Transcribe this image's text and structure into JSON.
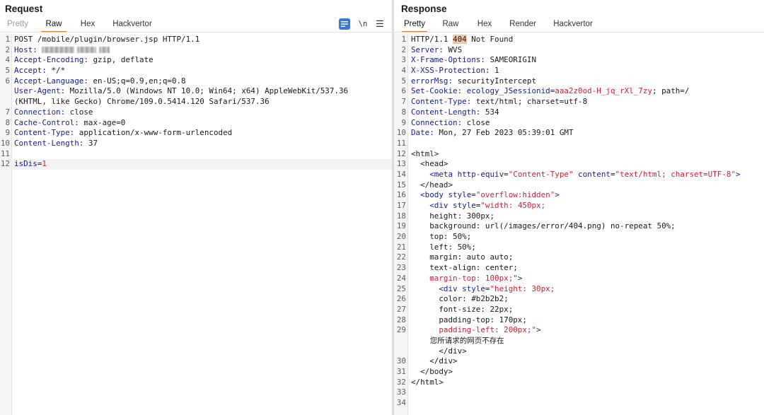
{
  "request": {
    "title": "Request",
    "tabs": [
      "Pretty",
      "Raw",
      "Hex",
      "Hackvertor"
    ],
    "active_tab": "Raw",
    "toolbar": {
      "wrap_icon": "wrap-lines-icon",
      "newline_label": "\\n",
      "menu_icon": "hamburger-menu-icon"
    },
    "lines": {
      "l1": "POST /mobile/plugin/browser.jsp HTTP/1.1",
      "l2k": "Host:",
      "l3k": "Accept-Encoding:",
      "l3v": " gzip, deflate",
      "l4k": "Accept:",
      "l4v": " */*",
      "l5k": "Accept-Language:",
      "l5v": " en-US;q=0.9,en;q=0.8",
      "l6k": "User-Agent:",
      "l6v": " Mozilla/5.0 (Windows NT 10.0; Win64; x64) AppleWebKit/537.36",
      "l6c": "(KHTML, like Gecko) Chrome/109.0.5414.120 Safari/537.36",
      "l7k": "Connection:",
      "l7v": " close",
      "l8k": "Cache-Control:",
      "l8v": " max-age=0",
      "l9k": "Content-Type:",
      "l9v": " application/x-www-form-urlencoded",
      "l10k": "Content-Length:",
      "l10v": " 37",
      "l12k": "isDis",
      "l12e": "=",
      "l12v": "1"
    },
    "numbers": [
      "1",
      "2",
      "3",
      "4",
      "5",
      "6",
      "",
      "7",
      "8",
      "9",
      "10",
      "11",
      "12"
    ]
  },
  "response": {
    "title": "Response",
    "tabs": [
      "Pretty",
      "Raw",
      "Hex",
      "Render",
      "Hackvertor"
    ],
    "active_tab": "Pretty",
    "lines": {
      "l1a": "HTTP/1.1 ",
      "l1b": "404",
      "l1c": " Not Found",
      "l2k": "Server:",
      "l2v": " WVS",
      "l3k": "X-Frame-Options:",
      "l3v": " SAMEORIGIN",
      "l4k": "X-XSS-Protection:",
      "l4v": " 1",
      "l5k": "errorMsg:",
      "l5v": " securityIntercept",
      "l6k": "Set-Cookie:",
      "l6a": " ecology_JSessionid",
      "l6e": "=",
      "l6b": "aaa2z0od-H_jq_rXl_7zy",
      "l6c": "; path=/",
      "l7k": "Content-Type:",
      "l7v": " text/html; charset=utf-8",
      "l8k": "Content-Length:",
      "l8v": " 534",
      "l9k": "Connection:",
      "l9v": " close",
      "l10k": "Date:",
      "l10v": " Mon, 27 Feb 2023 05:39:01 GMT",
      "l12": "<html>",
      "l13": "  <head>",
      "l14a": "    <meta",
      "l14b": " http-equiv",
      "l14e": "=",
      "l14c": "\"Content-Type\"",
      "l14d": " content",
      "l14f": "=",
      "l14g": "\"text/html; charset=UTF-8\"",
      "l14h": ">",
      "l15": "  </head>",
      "l16a": "  <body",
      "l16b": " style",
      "l16e": "=",
      "l16c": "\"overflow:hidden\"",
      "l16d": ">",
      "l17a": "    <div",
      "l17b": " style",
      "l17e": "=",
      "l17c": "\"width: 450px;",
      "l18": "    height: 300px;",
      "l19": "    background: url(/images/error/404.png) no-repeat 50%;",
      "l20": "    top: 50%;",
      "l21": "    left: 50%;",
      "l22": "    margin: auto auto;",
      "l23": "    text-align: center;",
      "l24a": "    margin-top: 100px;\"",
      "l24b": ">",
      "l25a": "      <div",
      "l25b": " style",
      "l25e": "=",
      "l25c": "\"height: 30px;",
      "l26": "      color: #b2b2b2;",
      "l27": "      font-size: 22px;",
      "l28": "      padding-top: 170px;",
      "l29a": "      padding-left: 200px;\"",
      "l29b": ">",
      "l29c": "        您所请求的网页不存在",
      "l29d": "      </div>",
      "l30": "    </div>",
      "l31": "  </body>",
      "l32": "</html>"
    },
    "numbers": [
      "1",
      "2",
      "3",
      "4",
      "5",
      "6",
      "7",
      "8",
      "9",
      "10",
      "11",
      "12",
      "13",
      "14",
      "15",
      "16",
      "17",
      "18",
      "19",
      "20",
      "21",
      "22",
      "23",
      "24",
      "25",
      "26",
      "27",
      "28",
      "29",
      "",
      "",
      "30",
      "31",
      "32",
      "33",
      "34"
    ]
  }
}
